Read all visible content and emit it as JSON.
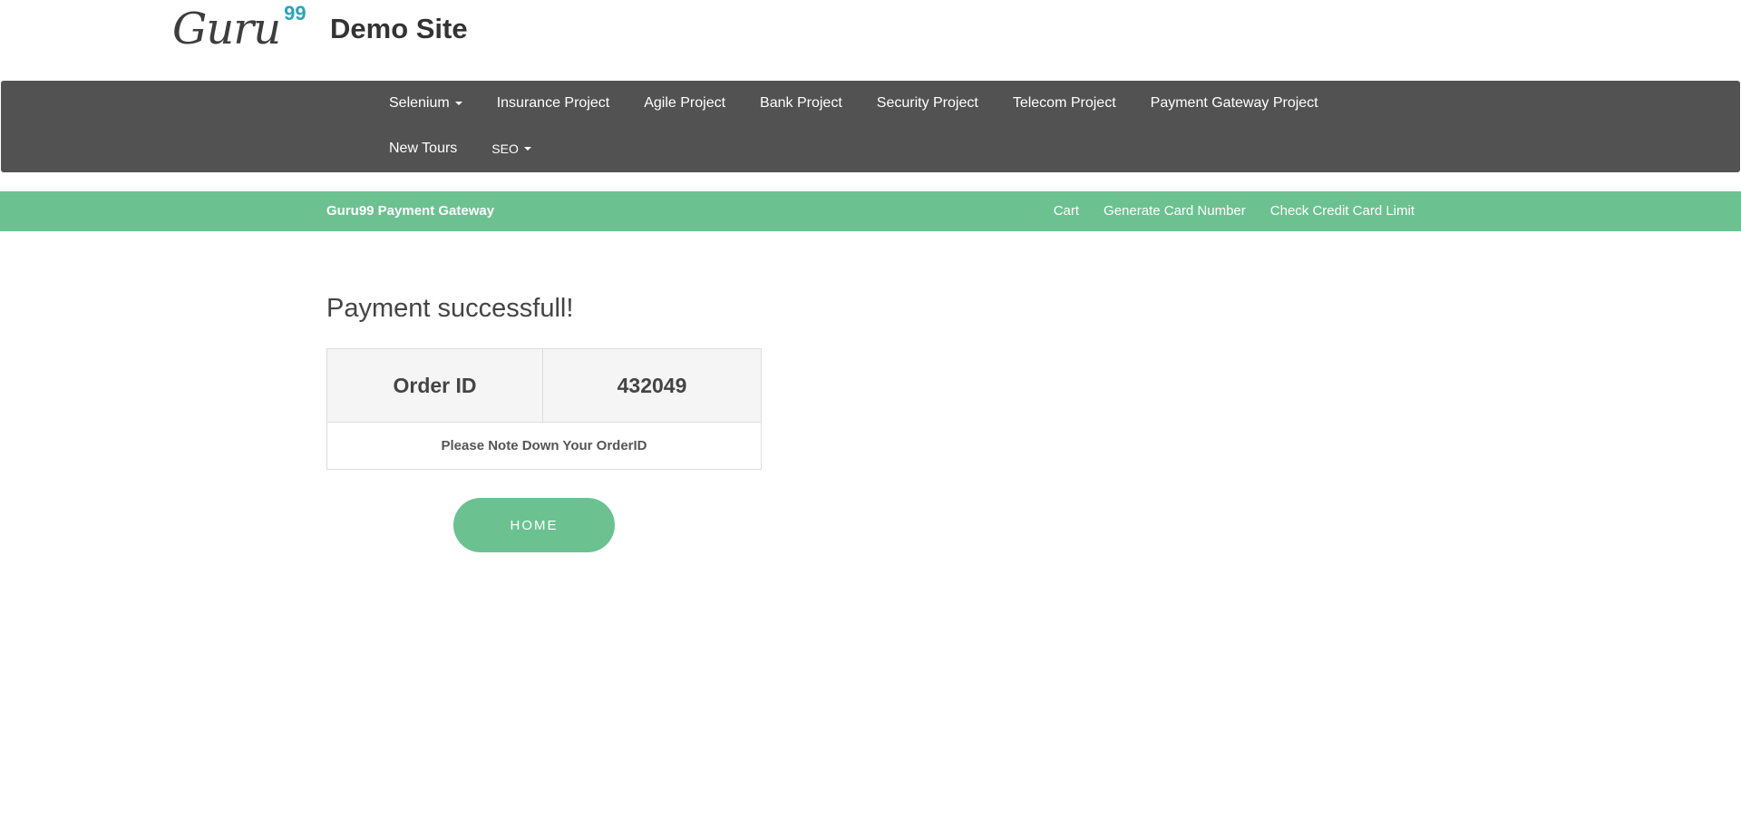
{
  "header": {
    "logo_text": "Guru",
    "logo_sup": "99",
    "site_title": "Demo Site"
  },
  "top_nav": {
    "items": [
      {
        "label": "Selenium",
        "dropdown": true
      },
      {
        "label": "Insurance Project",
        "dropdown": false
      },
      {
        "label": "Agile Project",
        "dropdown": false
      },
      {
        "label": "Bank Project",
        "dropdown": false
      },
      {
        "label": "Security Project",
        "dropdown": false
      },
      {
        "label": "Telecom Project",
        "dropdown": false
      },
      {
        "label": "Payment Gateway Project",
        "dropdown": false
      },
      {
        "label": "New Tours",
        "dropdown": false
      },
      {
        "label": "SEO",
        "dropdown": true
      }
    ]
  },
  "sub_nav": {
    "brand": "Guru99 Payment Gateway",
    "links": [
      "Cart",
      "Generate Card Number",
      "Check Credit Card Limit"
    ]
  },
  "main": {
    "heading": "Payment successfull!",
    "order_label": "Order ID",
    "order_id": "432049",
    "note": "Please Note Down Your OrderID",
    "home_button": "HOME"
  },
  "colors": {
    "nav_bg": "#525252",
    "accent_green": "#6cc190",
    "logo_sup": "#2aa4b8"
  }
}
